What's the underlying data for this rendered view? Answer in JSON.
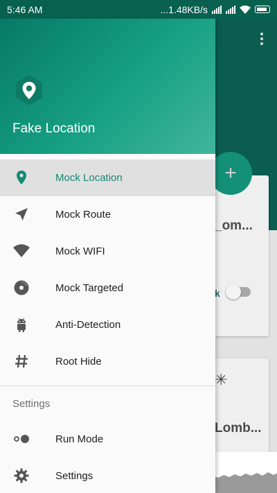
{
  "statusbar": {
    "time": "5:46 AM",
    "net_speed": "...1.48KB/s"
  },
  "drawer": {
    "app_name": "Fake Location",
    "items": [
      {
        "label": "Mock Location",
        "icon": "map-pin-icon",
        "active": true
      },
      {
        "label": "Mock Route",
        "icon": "navigation-arrow-icon",
        "active": false
      },
      {
        "label": "Mock WIFI",
        "icon": "wifi-icon",
        "active": false
      },
      {
        "label": "Mock Targeted",
        "icon": "target-disc-icon",
        "active": false
      },
      {
        "label": "Anti-Detection",
        "icon": "android-icon",
        "active": false
      },
      {
        "label": "Root Hide",
        "icon": "hash-icon",
        "active": false
      }
    ],
    "settings_section": {
      "title": "Settings",
      "items": [
        {
          "label": "Run Mode",
          "icon": "toggle-dots-icon"
        },
        {
          "label": "Settings",
          "icon": "gear-icon"
        }
      ]
    }
  },
  "background": {
    "fab_label": "+",
    "card1_title": "_om...",
    "card1_toggle_label": "k",
    "card2_title": "Lomb...",
    "card2_symbol": "✳"
  },
  "colors": {
    "accent": "#148a74",
    "header_dark": "#08604f"
  }
}
